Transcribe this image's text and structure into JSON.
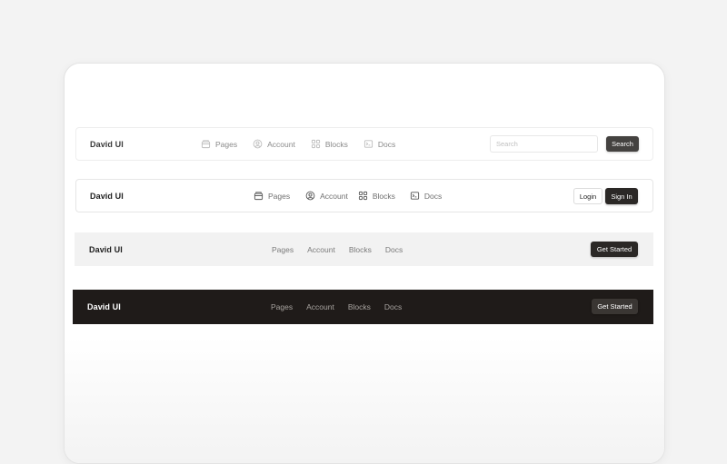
{
  "nav1": {
    "brand": "David UI",
    "links": [
      {
        "label": "Pages",
        "icon": "pages-icon"
      },
      {
        "label": "Account",
        "icon": "account-icon"
      },
      {
        "label": "Blocks",
        "icon": "blocks-icon"
      },
      {
        "label": "Docs",
        "icon": "docs-icon"
      }
    ],
    "search_placeholder": "Search",
    "search_button": "Search"
  },
  "nav2": {
    "brand": "David UI",
    "links": [
      {
        "label": "Pages",
        "icon": "pages-icon"
      },
      {
        "label": "Account",
        "icon": "account-icon"
      },
      {
        "label": "Blocks",
        "icon": "blocks-icon"
      },
      {
        "label": "Docs",
        "icon": "docs-icon"
      }
    ],
    "login_button": "Login",
    "signin_button": "Sign In"
  },
  "nav3": {
    "brand": "David UI",
    "links": [
      {
        "label": "Pages"
      },
      {
        "label": "Account"
      },
      {
        "label": "Blocks"
      },
      {
        "label": "Docs"
      }
    ],
    "cta_button": "Get Started"
  },
  "nav4": {
    "brand": "David UI",
    "links": [
      {
        "label": "Pages"
      },
      {
        "label": "Account"
      },
      {
        "label": "Blocks"
      },
      {
        "label": "Docs"
      }
    ],
    "cta_button": "Get Started"
  },
  "colors": {
    "background": "#f3f3f3",
    "card": "#ffffff",
    "dark_button": "#2b2826",
    "dark_nav": "#1f1b19",
    "link_text": "#7a7a7a"
  }
}
